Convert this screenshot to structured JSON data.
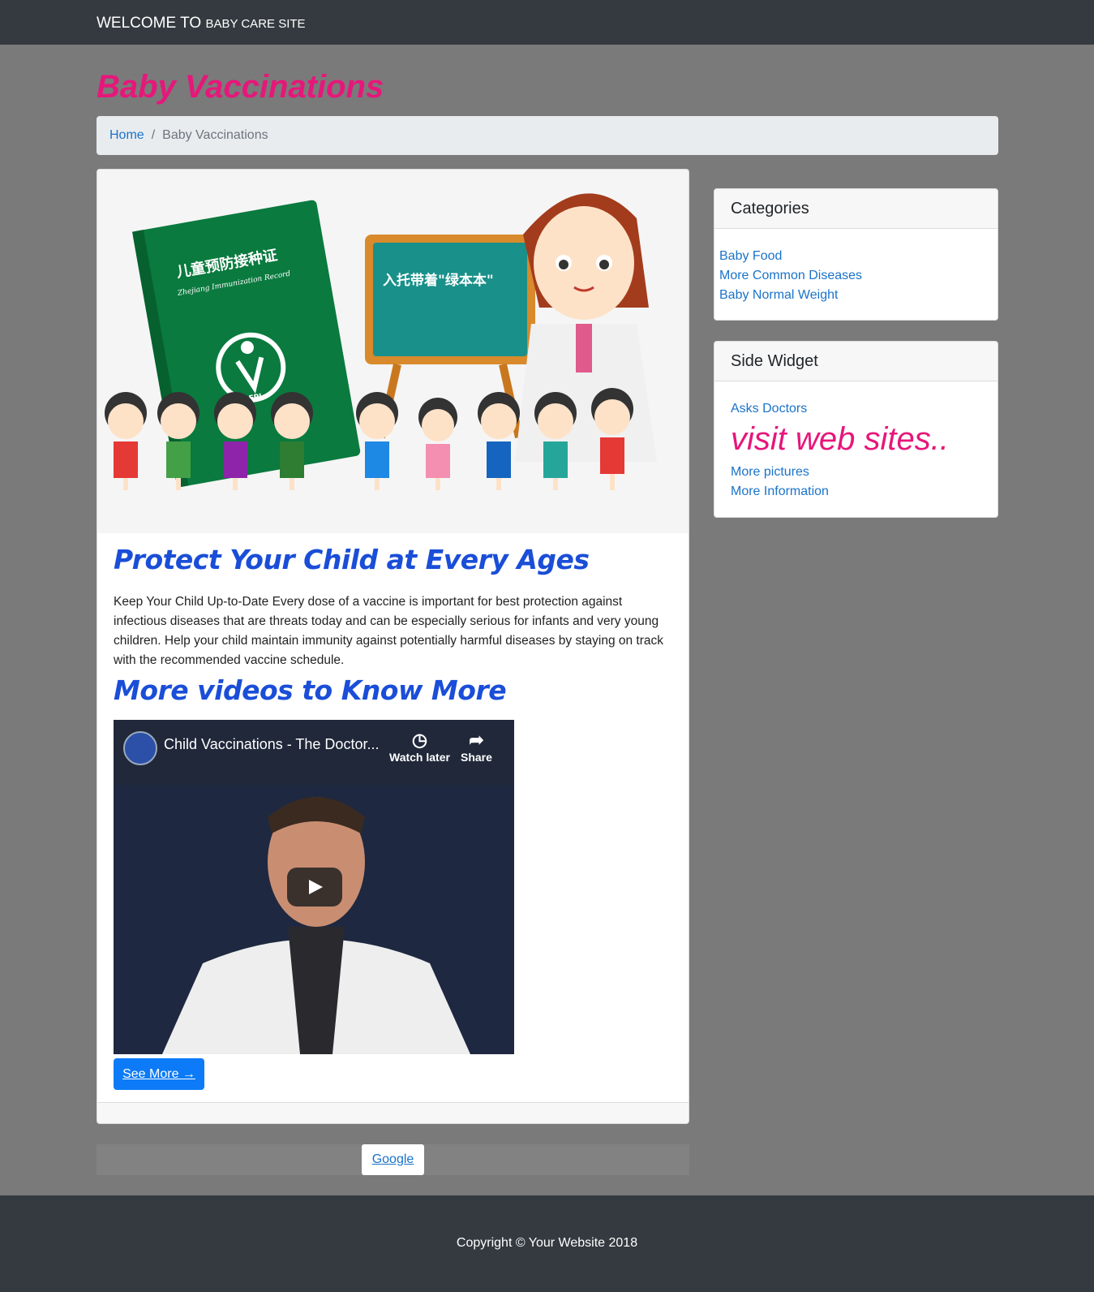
{
  "navbar": {
    "brand_main": "WELCOME TO",
    "brand_small": "baby care site"
  },
  "page": {
    "title": "Baby Vaccinations"
  },
  "breadcrumb": {
    "home": "Home",
    "separator": "/",
    "current": "Baby Vaccinations"
  },
  "hero": {
    "book_text_1": "儿童预防接种证",
    "book_text_2": "Zhejiang Immunization Record",
    "book_badge": "EPI",
    "board_text": "入托带着\"绿本本\""
  },
  "article": {
    "heading": "Protect Your Child at Every Ages",
    "body": "Keep Your Child Up-to-Date Every dose of a vaccine is important for best protection against infectious diseases that are threats today and can be especially serious for infants and very young children. Help your child maintain immunity against potentially harmful diseases by staying on track with the recommended vaccine schedule.",
    "videos_heading": "More videos to Know More",
    "see_more": "See More →"
  },
  "video": {
    "title": "Child Vaccinations - The Doctor...",
    "watch_later": "Watch later",
    "share": "Share"
  },
  "pagination": {
    "button": "Google"
  },
  "categories": {
    "title": "Categories",
    "items": [
      "Baby Food",
      "More Common Diseases",
      "Baby Normal Weight"
    ]
  },
  "side_widget": {
    "title": "Side Widget",
    "link1": "Asks Doctors",
    "big_text": "visit web sites..",
    "link2": "More pictures",
    "link3": "More Information"
  },
  "footer": {
    "copyright": "Copyright © Your Website 2018"
  },
  "colors": {
    "accent_pink": "#e6177a",
    "heading_blue": "#1a4ed8",
    "link_blue": "#1a73c9",
    "navbar": "#343a40",
    "button_blue": "#0d7bf7"
  }
}
